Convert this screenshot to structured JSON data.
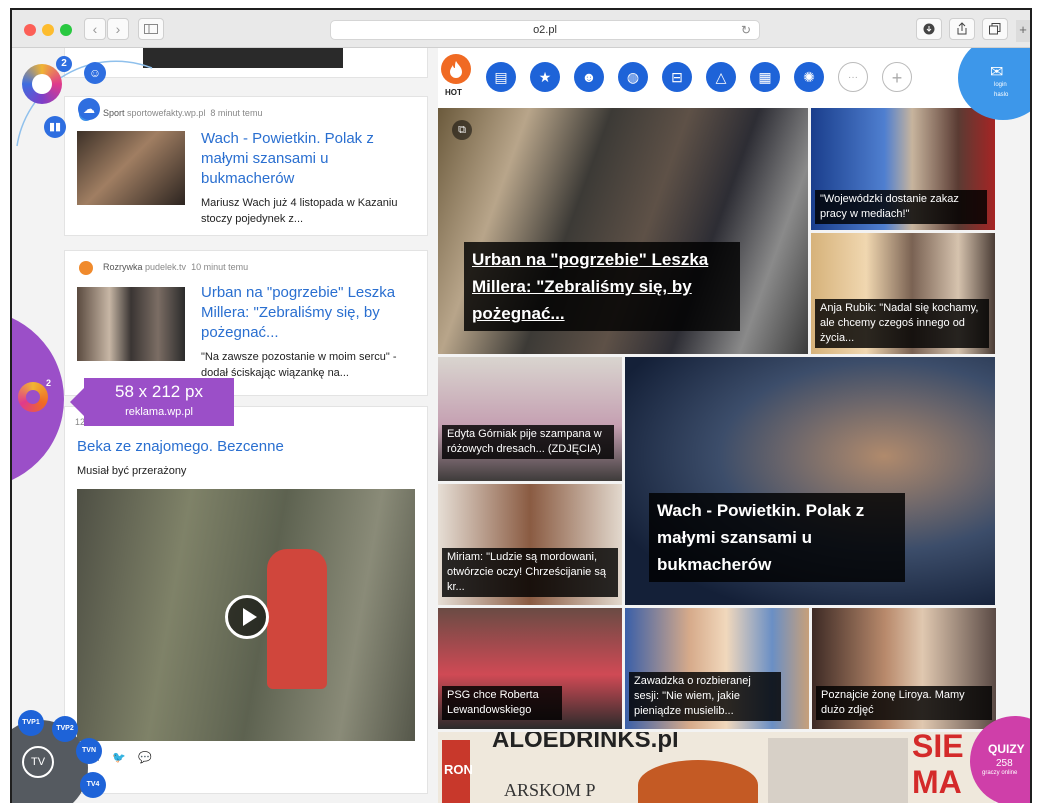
{
  "browser": {
    "url": "o2.pl",
    "reload_glyph": "↻",
    "back_glyph": "‹",
    "forward_glyph": "›"
  },
  "overlay": {
    "badge_count": "2",
    "ad_size": "58 x 212 px",
    "ad_source": "reklama.wp.pl",
    "ad_logo_sup": "2",
    "login_label": "login",
    "login_sub": "haslo",
    "quiz_label": "QUIZY",
    "quiz_count": "258",
    "quiz_sub": "graczy online",
    "tv_label": "TV",
    "channels": [
      "TVP1",
      "TVP2",
      "TVN",
      "TV4"
    ]
  },
  "iconbar": {
    "hot_label": "HOT",
    "icons": [
      "news-icon",
      "star-icon",
      "smile-icon",
      "basketball-icon",
      "cart-icon",
      "hanger-icon",
      "film-icon",
      "gear-icon"
    ],
    "more_glyph": "···",
    "add_glyph": "+"
  },
  "feed": {
    "items": [
      {
        "category": "Sport",
        "source": "sportowefakty.wp.pl",
        "time": "8 minut temu",
        "headline": "Wach - Powietkin. Polak z małymi szansami u bukmacherów",
        "lead": "Mariusz Wach już 4 listopada w Kazaniu stoczy pojedynek z..."
      },
      {
        "category": "Rozrywka",
        "source": "pudelek.tv",
        "time": "10 minut temu",
        "headline": "Urban na \"pogrzebie\" Leszka Millera: \"Zebraliśmy się, by pożegnać...",
        "lead": "\"Na zawsze pozostanie w moim sercu\" - dodał ściskając wiązankę na..."
      },
      {
        "time_partial": "12",
        "headline": "Beka ze znajomego. Bezcenne",
        "lead": "Musiał być przerażony"
      }
    ]
  },
  "grid": {
    "big_urban": "Urban na \"pogrzebie\" Leszka Millera: \"Zebraliśmy się, by pożegnać...",
    "wojewodzki": "\"Wojewódzki dostanie zakaz pracy w mediach!\"",
    "rubik": "Anja Rubik: \"Nadal się kochamy, ale chcemy czegoś innego od życia...",
    "gorniak": "Edyta Górniak pije szampana w różowych dresach... (ZDJĘCIA)",
    "wach_big": "Wach - Powietkin. Polak z małymi szansami u bukmacherów",
    "miriam": "Miriam: \"Ludzie są mordowani, otwórzcie oczy! Chrześcijanie są kr...",
    "psg": "PSG chce Roberta Lewandowskiego",
    "zawadzka": "Zawadzka o rozbieranej sesji: \"Nie wiem, jakie pieniądze musielib...",
    "liroy": "Poznajcie żonę Liroya. Mamy dużo zdjęć",
    "bottom_banner": "ALOEDRINKS.pl",
    "bottom_banner2": "ARSKOM P",
    "bottom_banner3": "RON",
    "bottom_banner4": "SIE",
    "bottom_banner5": "MA"
  },
  "colors": {
    "accent_blue": "#1e63d8",
    "promo_purple": "#9b4fc8",
    "link_blue": "#2a6fd0"
  }
}
